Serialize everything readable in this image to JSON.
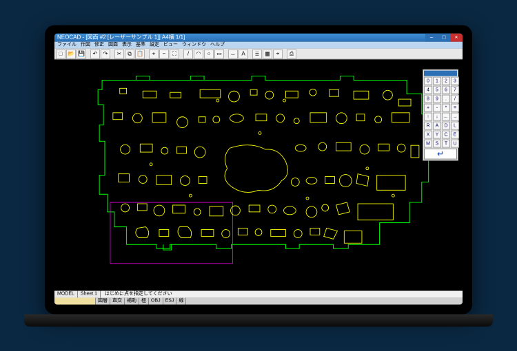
{
  "app_title": "NEOCAD - [図面 #2 [レーザーサンプル 1]] A4横 1/1]",
  "menu": [
    "ファイル",
    "作図",
    "修正",
    "図面",
    "表示",
    "基準",
    "設定",
    "ビュー",
    "ウィンドウ",
    "ヘルプ"
  ],
  "toolbar_icons": [
    "new",
    "open",
    "save",
    "sep",
    "undo",
    "redo",
    "sep",
    "cut",
    "copy",
    "paste",
    "sep",
    "zoom-in",
    "zoom-out",
    "zoom-fit",
    "sep",
    "line",
    "arc",
    "circle",
    "rect",
    "sep",
    "dim",
    "text",
    "sep",
    "layer",
    "grid",
    "snap",
    "sep",
    "print"
  ],
  "palette_buttons": [
    "0",
    "1",
    "2",
    "3",
    "4",
    "5",
    "6",
    "7",
    "8",
    "9",
    ".",
    "/",
    "+",
    "-",
    "*",
    "=",
    "↑",
    "↓",
    "←",
    "→",
    "R",
    "A",
    "D",
    "L",
    "X",
    "Y",
    "C",
    "E",
    "M",
    "S",
    "T",
    "U"
  ],
  "palette_enter": "↵",
  "status_tabs": [
    "MODEL",
    "Sheet 1"
  ],
  "status_msg": "はじめに点を指定してください",
  "status_cells": [
    "図層",
    "直交",
    "補助",
    "極",
    "OBJ",
    "ESJ",
    "線"
  ],
  "colors": {
    "outer_line": "#00ff00",
    "inner_line": "#ffff00",
    "selection": "#ff00ff"
  }
}
